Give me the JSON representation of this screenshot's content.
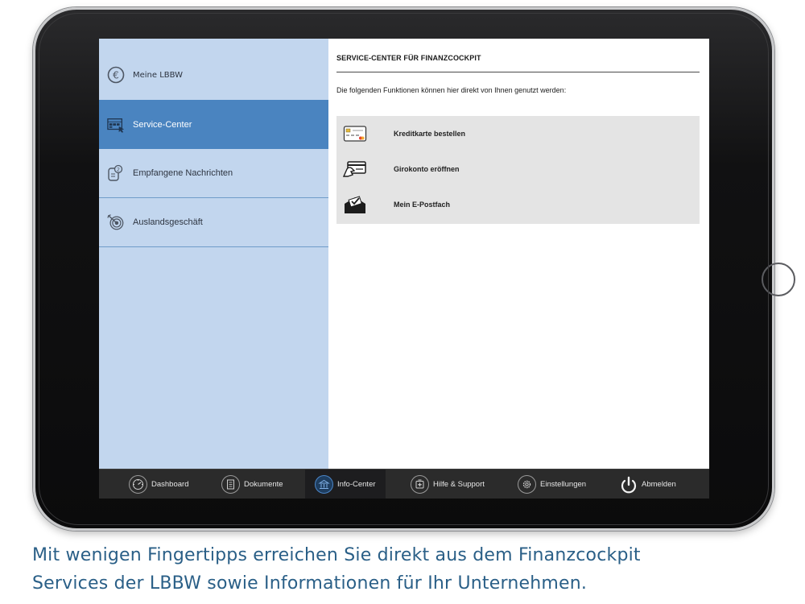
{
  "sidebar": {
    "items": [
      {
        "label": "Meine LBBW",
        "icon": "euro-icon"
      },
      {
        "label": "Service-Center",
        "icon": "service-center-icon"
      },
      {
        "label": "Empfangene Nachrichten",
        "icon": "messages-icon"
      },
      {
        "label": "Auslandsgeschäft",
        "icon": "target-icon"
      }
    ],
    "active_index": 1
  },
  "main": {
    "title": "SERVICE-CENTER FÜR FINANZCOCKPIT",
    "description": "Die folgenden Funktionen können hier direkt von Ihnen genutzt werden:",
    "functions": [
      {
        "label": "Kreditkarte bestellen",
        "icon": "credit-card-icon"
      },
      {
        "label": "Girokonto eröffnen",
        "icon": "hand-card-icon"
      },
      {
        "label": "Mein E-Postfach",
        "icon": "mailbox-icon"
      }
    ]
  },
  "tabbar": {
    "tabs": [
      {
        "label": "Dashboard",
        "icon": "dashboard-icon"
      },
      {
        "label": "Dokumente",
        "icon": "documents-icon"
      },
      {
        "label": "Info-Center",
        "icon": "info-center-icon"
      },
      {
        "label": "Hilfe & Support",
        "icon": "help-support-icon"
      },
      {
        "label": "Einstellungen",
        "icon": "settings-icon"
      },
      {
        "label": "Abmelden",
        "icon": "power-icon"
      }
    ],
    "active_index": 2
  },
  "caption": {
    "line1": "Mit wenigen Fingertipps erreichen Sie direkt aus dem Finanzcockpit",
    "line2": "Services der LBBW sowie Informationen für Ihr Unternehmen."
  },
  "colors": {
    "sidebar_bg": "#c2d6ee",
    "sidebar_active": "#4a84c0",
    "tabbar_bg": "#2b2b2b",
    "caption_text": "#2a5f87",
    "panel_bg": "#e4e4e4"
  }
}
